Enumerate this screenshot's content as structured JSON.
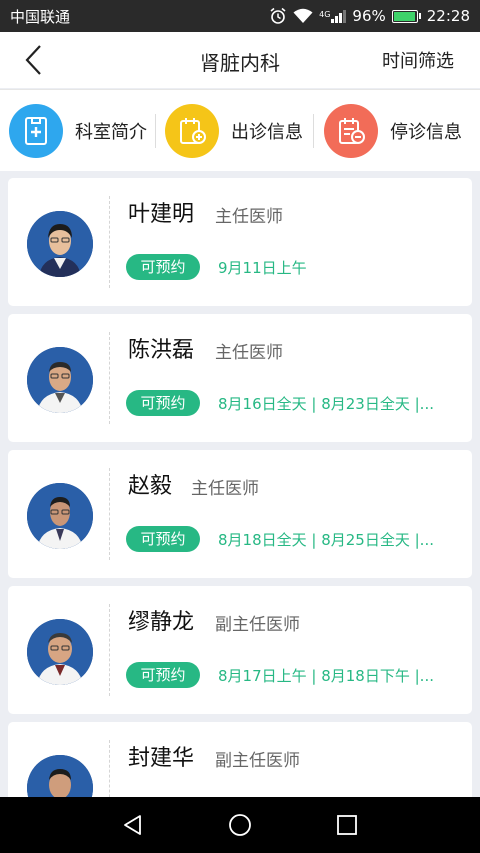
{
  "status_bar": {
    "carrier": "中国联通",
    "network": "4G",
    "battery": "96%",
    "battery_level": 0.96,
    "time": "22:28"
  },
  "header": {
    "title": "肾脏内科",
    "filter_label": "时间筛选"
  },
  "actions": [
    {
      "label": "科室简介",
      "icon": "department-intro-icon",
      "color": "#2ea7ee"
    },
    {
      "label": "出诊信息",
      "icon": "clinic-schedule-icon",
      "color": "#f5c518"
    },
    {
      "label": "停诊信息",
      "icon": "clinic-suspension-icon",
      "color": "#f26c58"
    }
  ],
  "doctors": [
    {
      "name": "叶建明",
      "title": "主任医师",
      "badge": "可预约",
      "schedule": "9月11日上午"
    },
    {
      "name": "陈洪磊",
      "title": "主任医师",
      "badge": "可预约",
      "schedule": "8月16日全天 | 8月23日全天 |..."
    },
    {
      "name": "赵毅",
      "title": "主任医师",
      "badge": "可预约",
      "schedule": "8月18日全天 | 8月25日全天 |..."
    },
    {
      "name": "缪静龙",
      "title": "副主任医师",
      "badge": "可预约",
      "schedule": "8月17日上午 | 8月18日下午 |..."
    },
    {
      "name": "封建华",
      "title": "副主任医师",
      "badge": "",
      "schedule": ""
    }
  ],
  "colors": {
    "accent_green": "#27b884",
    "status_bar": "#2a2a2a",
    "background": "#eceef3"
  }
}
